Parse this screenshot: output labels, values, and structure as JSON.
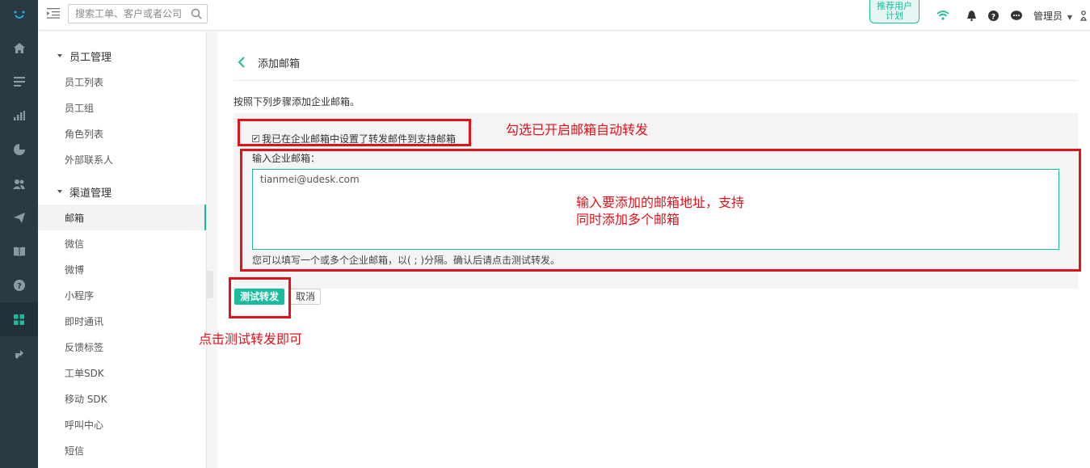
{
  "topbar": {
    "search_placeholder": "搜索工单、客户或者公司",
    "promo_line1": "推荐用户",
    "promo_line2": "计划",
    "admin_label": "管理员"
  },
  "sidebar": {
    "groups": [
      {
        "title": "员工管理",
        "items": [
          "员工列表",
          "员工组",
          "角色列表",
          "外部联系人"
        ]
      },
      {
        "title": "渠道管理",
        "items": [
          "邮箱",
          "微信",
          "微博",
          "小程序",
          "即时通讯",
          "反馈标签",
          "工单SDK",
          "移动 SDK",
          "呼叫中心",
          "短信"
        ]
      }
    ],
    "active_item": "邮箱"
  },
  "main": {
    "title": "添加邮箱",
    "intro": "按照下列步骤添加企业邮箱。",
    "checkbox_label": "我已在企业邮箱中设置了转发邮件到支持邮箱",
    "checkbox_checked": true,
    "email_label": "输入企业邮箱：",
    "email_value": "tianmei@udesk.com",
    "hint": "您可以填写一个或多个企业邮箱，以( ; )分隔。确认后请点击测试转发。",
    "test_button": "测试转发",
    "cancel_button": "取消"
  },
  "annotations": {
    "check_note": "勾选已开启邮箱自动转发",
    "input_note_line1": "输入要添加的邮箱地址，支持",
    "input_note_line2": "同时添加多个邮箱",
    "button_note": "点击测试转发即可"
  },
  "colors": {
    "accent": "#1bbc9b",
    "rail": "#2b3a42",
    "annotation": "#e0121b"
  }
}
